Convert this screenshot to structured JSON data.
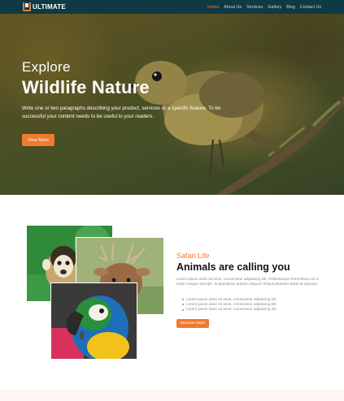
{
  "brand": {
    "name": "ULTIMATE"
  },
  "colors": {
    "accent": "#f07a2f",
    "navbar": "#0f3a45"
  },
  "nav": {
    "items": [
      {
        "label": "Home",
        "active": true
      },
      {
        "label": "About Us",
        "active": false
      },
      {
        "label": "Services",
        "active": false
      },
      {
        "label": "Gallery",
        "active": false
      },
      {
        "label": "Blog",
        "active": false
      },
      {
        "label": "Contact Us",
        "active": false
      }
    ]
  },
  "hero": {
    "eyebrow": "Explore",
    "title": "Wildlife Nature",
    "description": "Write one or two paragraphs describing your product, services or a specific feature.  To be successful your content needs to be useful to your readers.",
    "button_label": "View More"
  },
  "about": {
    "eyebrow": "Safari Life",
    "title": "Animals are calling you",
    "text": "Lorem ipsum dolor sit amet, consectetur adipiscing elit. Pellentesque fermentum est in tortor congue suscipit. Suspendisse potenti.Aliquam finibus pharetra tellus at egestas.",
    "bullets": [
      "Lorem ipsum dolor sit amet, consectetur adipiscing elit.",
      "Lorem ipsum dolor sit amet, consectetur adipiscing elit.",
      "Lorem ipsum dolor sit amet, consectetur adipiscing elit."
    ],
    "button_label": "Discover More"
  },
  "icons": [
    "logo-icon"
  ]
}
